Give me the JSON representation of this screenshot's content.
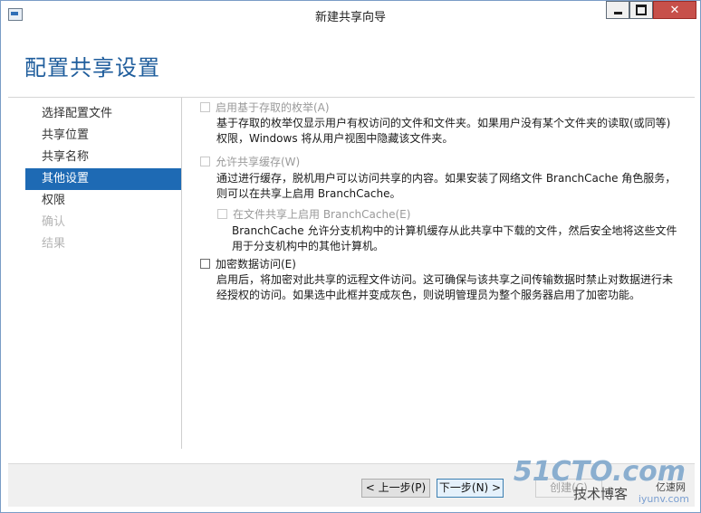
{
  "window": {
    "title": "新建共享向导",
    "controls": {
      "minimize": "minimize",
      "maximize": "maximize",
      "close": "✕"
    }
  },
  "header": {
    "page_title": "配置共享设置"
  },
  "sidebar": {
    "items": [
      {
        "label": "选择配置文件",
        "state": "normal"
      },
      {
        "label": "共享位置",
        "state": "normal"
      },
      {
        "label": "共享名称",
        "state": "normal"
      },
      {
        "label": "其他设置",
        "state": "active"
      },
      {
        "label": "权限",
        "state": "normal"
      },
      {
        "label": "确认",
        "state": "disabled"
      },
      {
        "label": "结果",
        "state": "disabled"
      }
    ]
  },
  "options": {
    "abe": {
      "label": "启用基于存取的枚举(A)",
      "desc": "基于存取的枚举仅显示用户有权访问的文件和文件夹。如果用户没有某个文件夹的读取(或同等)权限，Windows 将从用户视图中隐藏该文件夹。"
    },
    "cache": {
      "label": "允许共享缓存(W)",
      "desc": "通过进行缓存，脱机用户可以访问共享的内容。如果安装了网络文件 BranchCache 角色服务，则可以在共享上启用 BranchCache。"
    },
    "branchcache": {
      "label": "在文件共享上启用 BranchCache(E)",
      "desc": "BranchCache 允许分支机构中的计算机缓存从此共享中下载的文件，然后安全地将这些文件用于分支机构中的其他计算机。"
    },
    "encrypt": {
      "label": "加密数据访问(E)",
      "desc": "启用后，将加密对此共享的远程文件访问。这可确保与该共享之间传输数据时禁止对数据进行未经授权的访问。如果选中此框并变成灰色，则说明管理员为整个服务器启用了加密功能。"
    }
  },
  "footer": {
    "prev": "< 上一步(P)",
    "next": "下一步(N) >",
    "create": "创建(C)"
  },
  "watermark": {
    "site": "51CTO.com",
    "blog": "技术博客",
    "brand": "亿速网",
    "url": "iyunv.com"
  }
}
